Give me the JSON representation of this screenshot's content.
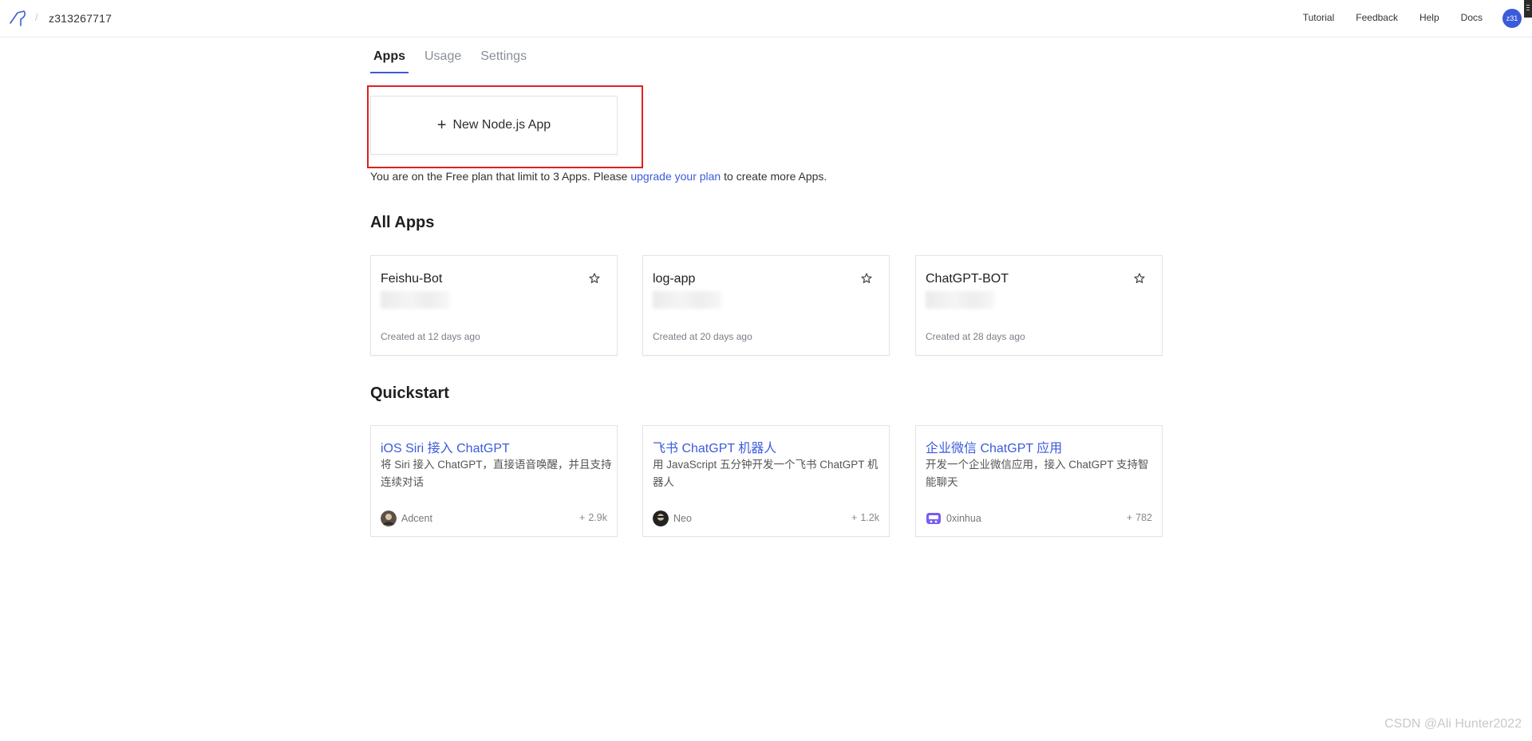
{
  "header": {
    "username": "z313267717",
    "nav": [
      "Tutorial",
      "Feedback",
      "Help",
      "Docs"
    ],
    "avatar_text": "z31"
  },
  "tabs": [
    {
      "label": "Apps",
      "active": true
    },
    {
      "label": "Usage",
      "active": false
    },
    {
      "label": "Settings",
      "active": false
    }
  ],
  "new_app": {
    "label": "New Node.js App"
  },
  "plan_note": {
    "before": "You are on the Free plan that limit to 3 Apps. Please ",
    "link": "upgrade your plan",
    "after": " to create more Apps."
  },
  "all_apps": {
    "title": "All Apps",
    "items": [
      {
        "name": "Feishu-Bot",
        "created": "Created at 12 days ago"
      },
      {
        "name": "log-app",
        "created": "Created at 20 days ago"
      },
      {
        "name": "ChatGPT-BOT",
        "created": "Created at 28 days ago"
      }
    ]
  },
  "quickstart": {
    "title": "Quickstart",
    "items": [
      {
        "title": "iOS Siri 接入 ChatGPT",
        "desc": "将 Siri 接入 ChatGPT，直接语音唤醒，并且支持连续对话",
        "author": "Adcent",
        "count": "2.9k"
      },
      {
        "title": "飞书 ChatGPT 机器人",
        "desc": "用 JavaScript 五分钟开发一个飞书 ChatGPT 机器人",
        "author": "Neo",
        "count": "1.2k"
      },
      {
        "title": "企业微信 ChatGPT 应用",
        "desc": "开发一个企业微信应用，接入 ChatGPT 支持智能聊天",
        "author": "0xinhua",
        "count": "782"
      }
    ]
  },
  "watermark": "CSDN @Ali Hunter2022",
  "colors": {
    "accent": "#3b5bdb",
    "highlight_border": "#e02020"
  }
}
